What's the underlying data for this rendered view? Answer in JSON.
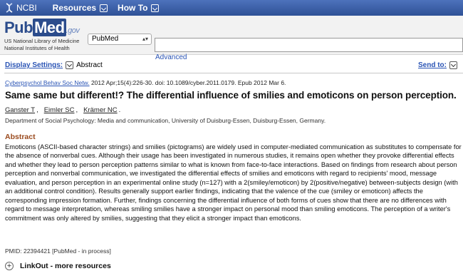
{
  "topbar": {
    "ncbi": "NCBI",
    "menus": [
      "Resources",
      "How To"
    ]
  },
  "search": {
    "logo": {
      "pub": "Pub",
      "med": "Med",
      "gov": ".gov"
    },
    "logo_sub": [
      "US National Library of Medicine",
      "National Institutes of Health"
    ],
    "database": "PubMed",
    "query": "",
    "advanced": "Advanced"
  },
  "settings": {
    "display_label": "Display Settings:",
    "display_value": "Abstract",
    "send_to": "Send to:"
  },
  "article": {
    "journal": "Cyberpsychol Behav Soc Netw.",
    "citation_rest": " 2012 Apr;15(4):226-30. doi: 10.1089/cyber.2011.0179. Epub 2012 Mar 6.",
    "title": "Same same but different!? The differential influence of smilies and emoticons on person perception.",
    "authors": [
      "Ganster T",
      "Eimler SC",
      "Krämer NC"
    ],
    "affiliation": "Department of Social Psychology: Media and communication, University of Duisburg-Essen, Duisburg-Essen, Germany.",
    "abstract_heading": "Abstract",
    "abstract": "Emoticons (ASCII-based character strings) and smilies (pictograms) are widely used in computer-mediated communication as substitutes to compensate for the absence of nonverbal cues. Although their usage has been investigated in numerous studies, it remains open whether they provoke differential effects and whether they lead to person perception patterns similar to what is known from face-to-face interactions. Based on findings from research about person perception and nonverbal communication, we investigated the differential effects of smilies and emoticons with regard to recipients' mood, message evaluation, and person perception in an experimental online study (n=127) with a 2(smiley/emoticon) by 2(positive/negative) between-subjects design (with an additional control condition). Results generally support earlier findings, indicating that the valence of the cue (smiley or emoticon) affects the corresponding impression formation. Further, findings concerning the differential influence of both forms of cues show that there are no differences with regard to message interpretation, whereas smiling smilies have a stronger impact on personal mood than smiling emoticons. The perception of a writer's commitment was only altered by smilies, suggesting that they elicit a stronger impact than emoticons.",
    "pmid": "PMID: 22394421 [PubMed - in process]",
    "linkout": "LinkOut - more resources"
  },
  "colors": {
    "topbar": "#2f5196",
    "link": "#2a54b5",
    "abstract_heading": "#9a4a1e"
  }
}
